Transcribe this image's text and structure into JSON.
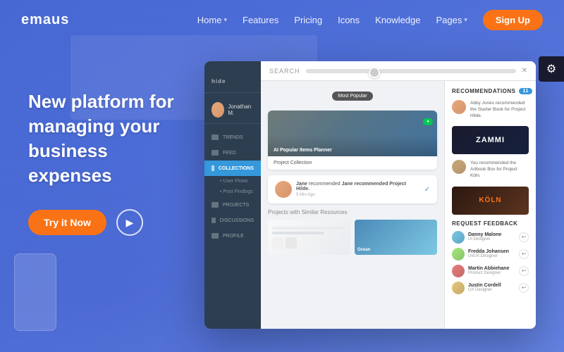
{
  "brand": {
    "name": "emaus"
  },
  "navbar": {
    "links": [
      {
        "label": "Home",
        "has_dropdown": true
      },
      {
        "label": "Features",
        "has_dropdown": false
      },
      {
        "label": "Pricing",
        "has_dropdown": false
      },
      {
        "label": "Icons",
        "has_dropdown": false
      },
      {
        "label": "Knowledge",
        "has_dropdown": false
      },
      {
        "label": "Pages",
        "has_dropdown": true
      }
    ],
    "signup_label": "Sign Up"
  },
  "hero": {
    "title": "New platform for managing your business expenses",
    "cta_label": "Try it Now"
  },
  "app": {
    "sidebar": {
      "logo": "hide",
      "username": "Jonathan M.",
      "items": [
        {
          "label": "TRENDS"
        },
        {
          "label": "FEED"
        },
        {
          "label": "COLLECTIONS",
          "active": true
        },
        {
          "sub1": "User Flows"
        },
        {
          "sub2": "Post Findings"
        },
        {
          "label": "PROJECTS"
        },
        {
          "label": "DISCUSSIONS"
        },
        {
          "label": "PROFILE"
        }
      ]
    },
    "search": {
      "label": "SEARCH"
    },
    "feed": {
      "badge": "Most Popular",
      "notification_text": "Jane recommended Project Hilde.",
      "time_ago": "5 Min Ago",
      "similar_label": "Projects with Similar Resources"
    },
    "recommendations": {
      "title": "RECOMMENDATIONS",
      "count": "11",
      "items": [
        {
          "text": "Abby Jones recommended the Starter Book for Project Hilde.",
          "image_label": "ZAMMI"
        },
        {
          "text": "You recommended the Artbook Box for Project Köln.",
          "image_label": "KÖLN"
        }
      ]
    },
    "feedback": {
      "title": "REQUEST FEEDBACK",
      "people": [
        {
          "name": "Danny Malone",
          "role": "UI Designer"
        },
        {
          "name": "Fredda Johansen",
          "role": "UI/UX Designer"
        },
        {
          "name": "Martin Abbiehane",
          "role": "Product Designer"
        },
        {
          "name": "Justin Cordell",
          "role": "UX Designer"
        }
      ]
    }
  }
}
